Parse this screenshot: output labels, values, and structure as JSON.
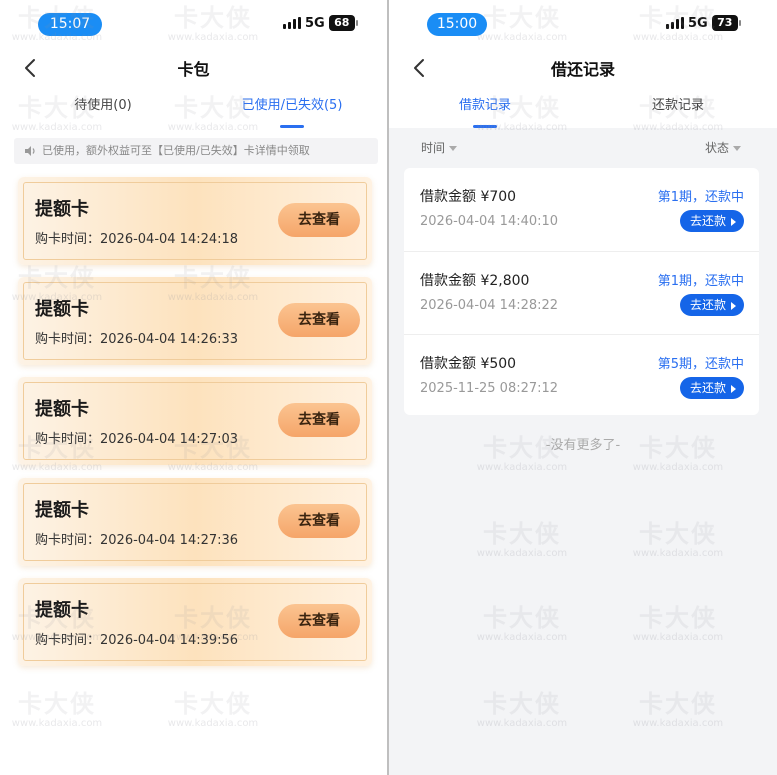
{
  "watermark": {
    "mark": "卡大侠",
    "url": "www.kadaxia.com"
  },
  "left": {
    "status": {
      "time": "15:07",
      "network": "5G",
      "battery": "68"
    },
    "nav": {
      "title": "卡包"
    },
    "tabs": [
      {
        "label": "待使用(0)",
        "active": false
      },
      {
        "label": "已使用/已失效(5)",
        "active": true
      }
    ],
    "notice": "已使用，额外权益可至【已使用/已失效】卡详情中领取",
    "cards": [
      {
        "title": "提额卡",
        "date": "购卡时间：2026-04-04 14:24:18",
        "button": "去查看"
      },
      {
        "title": "提额卡",
        "date": "购卡时间：2026-04-04 14:26:33",
        "button": "去查看"
      },
      {
        "title": "提额卡",
        "date": "购卡时间：2026-04-04 14:27:03",
        "button": "去查看"
      },
      {
        "title": "提额卡",
        "date": "购卡时间：2026-04-04 14:27:36",
        "button": "去查看"
      },
      {
        "title": "提额卡",
        "date": "购卡时间：2026-04-04 14:39:56",
        "button": "去查看"
      }
    ]
  },
  "right": {
    "status": {
      "time": "15:00",
      "network": "5G",
      "battery": "73"
    },
    "nav": {
      "title": "借还记录"
    },
    "tabs": [
      {
        "label": "借款记录",
        "active": true
      },
      {
        "label": "还款记录",
        "active": false
      }
    ],
    "list_header": {
      "time": "时间",
      "status": "状态"
    },
    "loans": [
      {
        "amount": "借款金额 ¥700",
        "time": "2026-04-04 14:40:10",
        "status": "第1期，还款中",
        "button": "去还款"
      },
      {
        "amount": "借款金额 ¥2,800",
        "time": "2026-04-04 14:28:22",
        "status": "第1期，还款中",
        "button": "去还款"
      },
      {
        "amount": "借款金额 ¥500",
        "time": "2025-11-25 08:27:12",
        "status": "第5期，还款中",
        "button": "去还款"
      }
    ],
    "no_more": "-没有更多了-"
  },
  "colors": {
    "accent": "#2a6ff0",
    "time_pill": "#1a8df5",
    "card_button": "#f5a569",
    "repay_button": "#1565e8"
  },
  "icons": [
    "back-icon",
    "speaker-icon",
    "caret-down-icon",
    "arrow-right-icon",
    "signal-icon",
    "battery-icon"
  ]
}
